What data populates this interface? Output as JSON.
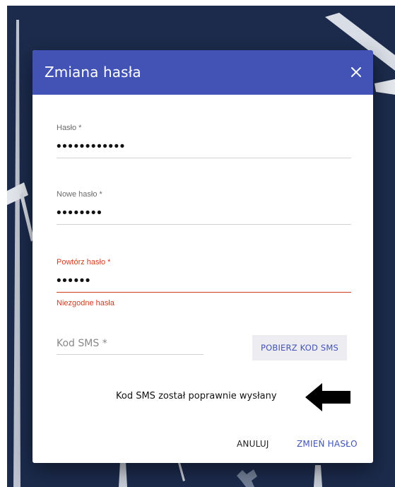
{
  "dialog": {
    "title": "Zmiana hasła"
  },
  "fields": {
    "password": {
      "label": "Hasło *",
      "value": "••••••••••••"
    },
    "new_password": {
      "label": "Nowe hasło *",
      "value": "••••••••"
    },
    "repeat_password": {
      "label": "Powtórz hasło *",
      "value": "••••••",
      "error": "Niezgodne hasła"
    },
    "sms_code": {
      "placeholder": "Kod SMS *",
      "value": ""
    }
  },
  "buttons": {
    "get_sms": "POBIERZ KOD SMS",
    "cancel": "ANULUJ",
    "change_password": "ZMIEŃ HASŁO"
  },
  "status": {
    "sms_sent": "Kod SMS został poprawnie wysłany"
  },
  "icons": {
    "close": "close-icon",
    "pointer": "arrow-left-icon"
  },
  "colors": {
    "header": "#4253b5",
    "accent": "#4253b5",
    "error": "#d23a1f",
    "background": "#1c2b4c"
  }
}
